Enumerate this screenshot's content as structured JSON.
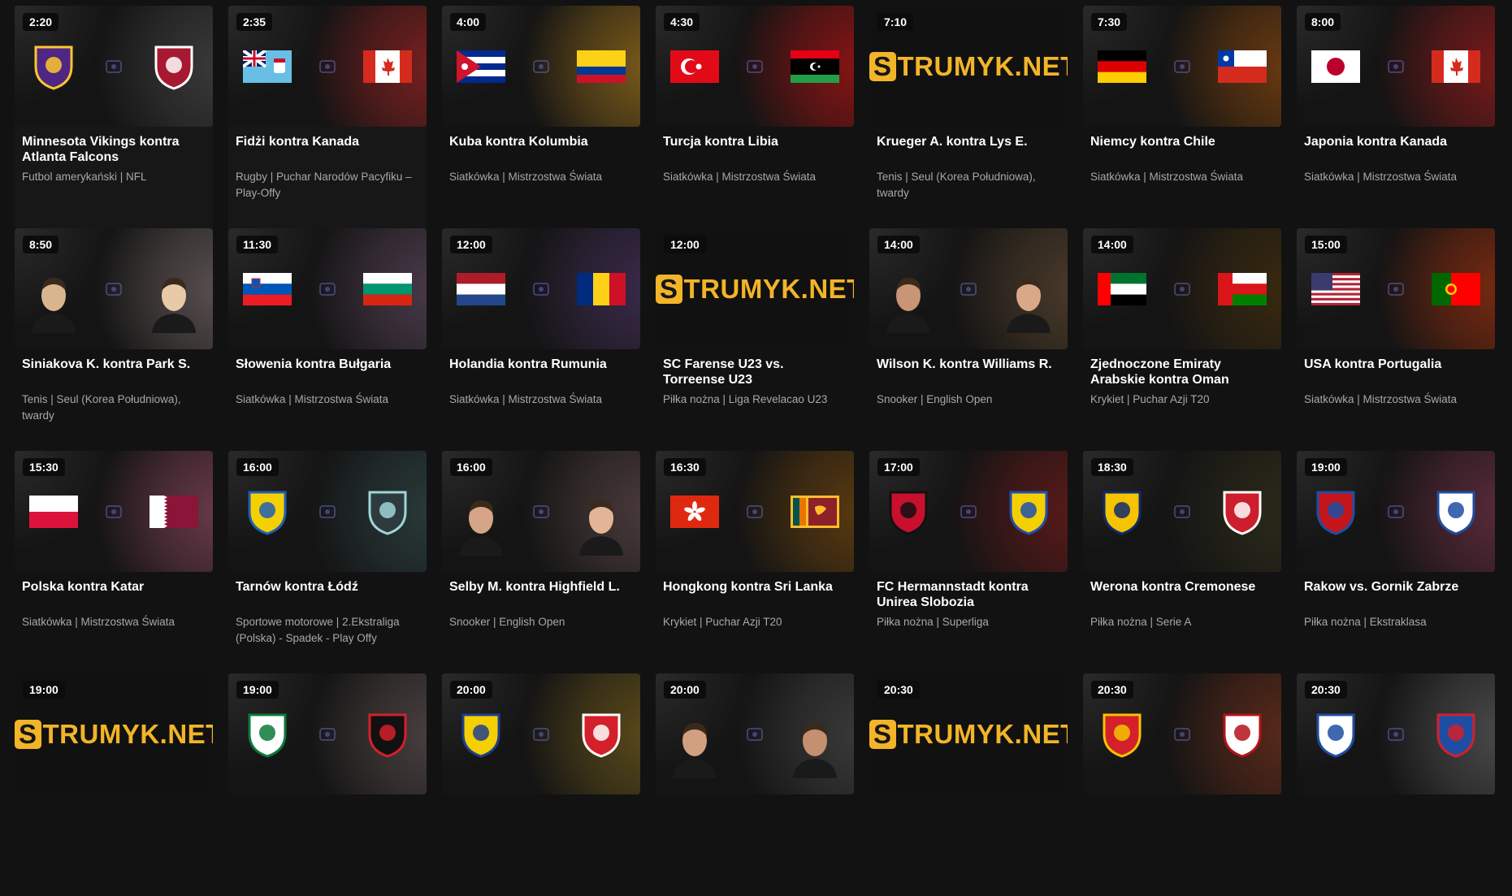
{
  "brand_text": "TRUMYK.NET",
  "brand_letter": "S",
  "events": [
    {
      "time": "2:20",
      "title": "Minnesota Vikings kontra Atlanta Falcons",
      "sub": "Futbol amerykański | NFL",
      "kind": "teams",
      "left": "vikings-helmet-icon",
      "right": "falcons-icon",
      "mid": "nfl-icon",
      "bg": "#3a3a3a",
      "active": true
    },
    {
      "time": "2:35",
      "title": "Fidżi kontra Kanada",
      "sub": "Rugby | Puchar Narodów Pacyfiku – Play-Offy",
      "kind": "flags",
      "left": "fiji",
      "right": "canada",
      "mid": "rugby-cup-icon",
      "bg": "#7a2020",
      "active": true
    },
    {
      "time": "4:00",
      "title": "Kuba kontra Kolumbia",
      "sub": "Siatkówka | Mistrzostwa Świata",
      "kind": "flags",
      "left": "cuba",
      "right": "colombia",
      "mid": "volley-icon",
      "bg": "#7a5a1a"
    },
    {
      "time": "4:30",
      "title": "Turcja kontra Libia",
      "sub": "Siatkówka | Mistrzostwa Świata",
      "kind": "flags",
      "left": "turkey",
      "right": "libya",
      "mid": "volley-icon",
      "bg": "#8a1414"
    },
    {
      "time": "7:10",
      "title": "Krueger A. kontra Lys E.",
      "sub": "Tenis | Seul (Korea Południowa), twardy",
      "kind": "brand",
      "bg": "#111111"
    },
    {
      "time": "7:30",
      "title": "Niemcy kontra Chile",
      "sub": "Siatkówka | Mistrzostwa Świata",
      "kind": "flags",
      "left": "germany",
      "right": "chile",
      "mid": "volley-icon",
      "bg": "#6a3a10"
    },
    {
      "time": "8:00",
      "title": "Japonia kontra Kanada",
      "sub": "Siatkówka | Mistrzostwa Świata",
      "kind": "flags",
      "left": "japan",
      "right": "canada",
      "mid": "volley-icon",
      "bg": "#7a1a1a"
    },
    {
      "time": "8:50",
      "title": "Siniakova K. kontra Park S.",
      "sub": "Tenis | Seul (Korea Południowa), twardy",
      "kind": "players",
      "left": "#d9b58f",
      "right": "#e8c9a8",
      "mid": "wta-icon",
      "bg": "#5a5050"
    },
    {
      "time": "11:30",
      "title": "Słowenia kontra Bułgaria",
      "sub": "Siatkówka | Mistrzostwa Świata",
      "kind": "flags",
      "left": "slovenia",
      "right": "bulgaria",
      "mid": "volley-icon",
      "bg": "#4a3a4a"
    },
    {
      "time": "12:00",
      "title": "Holandia kontra Rumunia",
      "sub": "Siatkówka | Mistrzostwa Świata",
      "kind": "flags",
      "left": "netherlands",
      "right": "romania",
      "mid": "volley-icon",
      "bg": "#3a2a4a"
    },
    {
      "time": "12:00",
      "title": "SC Farense U23 vs. Torreense U23",
      "sub": "Piłka nożna | Liga Revelacao U23",
      "kind": "brand",
      "bg": "#111111"
    },
    {
      "time": "14:00",
      "title": "Wilson K. kontra Williams R.",
      "sub": "Snooker | English Open",
      "kind": "players",
      "left": "#c99577",
      "right": "#d8a888",
      "mid": "snooker-icon",
      "bg": "#4a3a2a"
    },
    {
      "time": "14:00",
      "title": "Zjednoczone Emiraty Arabskie kontra Oman",
      "sub": "Krykiet | Puchar Azji T20",
      "kind": "flags",
      "left": "uae",
      "right": "oman",
      "mid": "cricket-icon",
      "bg": "#3a2a10"
    },
    {
      "time": "15:00",
      "title": "USA kontra Portugalia",
      "sub": "Siatkówka | Mistrzostwa Świata",
      "kind": "flags",
      "left": "usa",
      "right": "portugal",
      "mid": "volley-icon",
      "bg": "#7a2a10"
    },
    {
      "time": "15:30",
      "title": "Polska kontra Katar",
      "sub": "Siatkówka | Mistrzostwa Świata",
      "kind": "flags",
      "left": "poland",
      "right": "qatar",
      "mid": "volley-icon",
      "bg": "#6a3a4a"
    },
    {
      "time": "16:00",
      "title": "Tarnów kontra Łódź",
      "sub": "Sportowe motorowe | 2.Ekstraliga (Polska) - Spadek - Play Offy",
      "kind": "teams",
      "left": "tarnow-badge-icon",
      "right": "orzel-badge-icon",
      "mid": "speedway-icon",
      "bg": "#2a3a3a"
    },
    {
      "time": "16:00",
      "title": "Selby M. kontra Highfield L.",
      "sub": "Snooker | English Open",
      "kind": "players",
      "left": "#d6a486",
      "right": "#e2b596",
      "mid": "snooker-icon",
      "bg": "#4a3a3a"
    },
    {
      "time": "16:30",
      "title": "Hongkong kontra Sri Lanka",
      "sub": "Krykiet | Puchar Azji T20",
      "kind": "flags",
      "left": "hongkong",
      "right": "srilanka",
      "mid": "cricket-icon",
      "bg": "#5a3a10"
    },
    {
      "time": "17:00",
      "title": "FC Hermannstadt kontra Unirea Slobozia",
      "sub": "Piłka nożna | Superliga",
      "kind": "teams",
      "left": "hermannstadt-badge-icon",
      "right": "slobozia-badge-icon",
      "mid": "superliga-icon",
      "bg": "#5a1a1a"
    },
    {
      "time": "18:30",
      "title": "Werona kontra Cremonese",
      "sub": "Piłka nożna | Serie A",
      "kind": "teams",
      "left": "verona-badge-icon",
      "right": "cremonese-badge-icon",
      "mid": "seriea-icon",
      "bg": "#2a2a1a"
    },
    {
      "time": "19:00",
      "title": "Rakow vs. Gornik Zabrze",
      "sub": "Piłka nożna | Ekstraklasa",
      "kind": "teams",
      "left": "rakow-badge-icon",
      "right": "gornik-badge-icon",
      "mid": "ekstraklasa-icon",
      "bg": "#5a2a3a"
    },
    {
      "time": "19:00",
      "title": "",
      "sub": "",
      "kind": "brand",
      "bg": "#111111"
    },
    {
      "time": "19:00",
      "title": "",
      "sub": "",
      "kind": "teams",
      "left": "rizespor-badge-icon",
      "right": "genclerbirligi-badge-icon",
      "mid": "superlig-icon",
      "bg": "#4a4040"
    },
    {
      "time": "20:00",
      "title": "",
      "sub": "",
      "kind": "teams",
      "left": "petrolul-badge-icon",
      "right": "dinamo-badge-icon",
      "mid": "superliga-icon",
      "bg": "#5a4a1a"
    },
    {
      "time": "20:00",
      "title": "",
      "sub": "",
      "kind": "players",
      "left": "#d0a080",
      "right": "#c49070",
      "mid": "snooker-icon",
      "bg": "#3a3a3a"
    },
    {
      "time": "20:30",
      "title": "",
      "sub": "",
      "kind": "brand",
      "bg": "#111111"
    },
    {
      "time": "20:30",
      "title": "",
      "sub": "",
      "kind": "teams",
      "left": "zaragoza-badge-icon",
      "right": "albacete-badge-icon",
      "mid": "laliga-icon",
      "bg": "#5a2a1a"
    },
    {
      "time": "20:30",
      "title": "",
      "sub": "",
      "kind": "teams",
      "left": "kalisz-badge-icon",
      "right": "polonia-badge-icon",
      "mid": "betclic-icon",
      "bg": "#4a4a4a"
    }
  ]
}
